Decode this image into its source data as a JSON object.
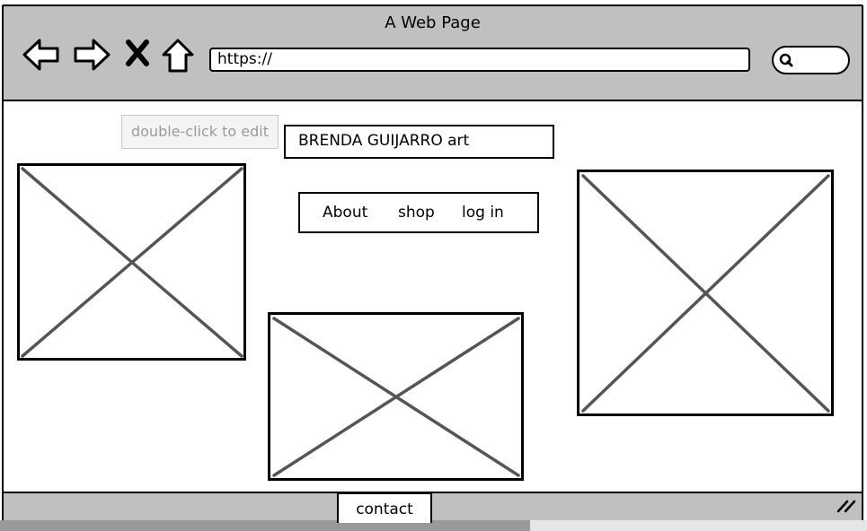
{
  "window": {
    "title": "A Web Page",
    "url": "https://",
    "nav_icons": [
      "back-arrow-icon",
      "forward-arrow-icon",
      "close-x-icon",
      "home-icon"
    ],
    "search_icon": "search-icon"
  },
  "page": {
    "edit_hint": "double-click to edit",
    "site_title": "BRENDA GUIJARRO art",
    "menu": {
      "about": "About",
      "shop": "shop",
      "login": "log in"
    },
    "footer_link": "contact",
    "image_placeholders": [
      "image-placeholder-left",
      "image-placeholder-center",
      "image-placeholder-right"
    ]
  },
  "colors": {
    "chrome": "#c0c0c0",
    "stroke": "#000000",
    "placeholder_stroke": "#555555",
    "hint_text": "#9a9a9a"
  }
}
